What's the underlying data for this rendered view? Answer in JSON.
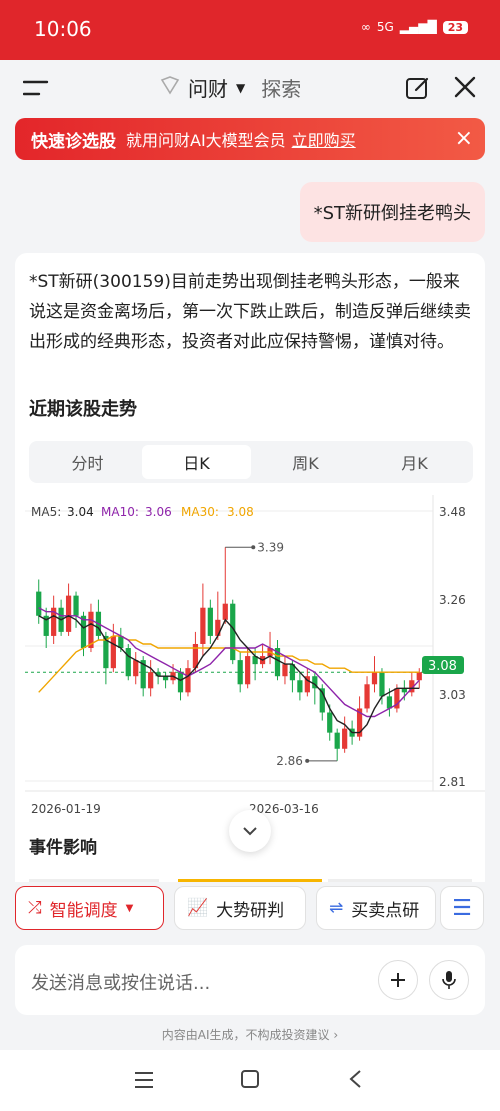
{
  "status_bar": {
    "time": "10:06",
    "network": "5G",
    "battery": "23"
  },
  "header": {
    "app_title": "问财",
    "secondary_tab": "探索"
  },
  "banner": {
    "title": "快速诊选股",
    "text": "就用问财AI大模型会员",
    "link": "立即购买"
  },
  "user_message": "*ST新研倒挂老鸭头",
  "answer": {
    "text": "*ST新研(300159)目前走势出现倒挂老鸭头形态，一般来说这是资金离场后，第一次下跌止跌后，制造反弹后继续卖出形成的经典形态，投资者对此应保持警惕，谨慎对待。",
    "section_title": "近期该股走势",
    "tabs": [
      "分时",
      "日K",
      "周K",
      "月K"
    ],
    "active_tab": "日K",
    "events_title": "事件影响"
  },
  "chart_data": {
    "type": "candlestick",
    "ma_labels": [
      {
        "name": "MA5:",
        "value": "3.04",
        "color": "#222222"
      },
      {
        "name": "MA10:",
        "value": "3.06",
        "color": "#8e24aa"
      },
      {
        "name": "MA30:",
        "value": "3.08",
        "color": "#f0a500"
      }
    ],
    "y_ticks": [
      "3.48",
      "3.26",
      "3.03",
      "2.81"
    ],
    "x_ticks": [
      "2026-01-19",
      "2026-03-16"
    ],
    "current_price": "3.08",
    "max_label": "3.39",
    "min_label": "2.86",
    "ylim": [
      2.81,
      3.48
    ],
    "candles": [
      [
        3.28,
        3.22,
        3.31,
        3.2
      ],
      [
        3.22,
        3.17,
        3.24,
        3.14
      ],
      [
        3.17,
        3.24,
        3.27,
        3.15
      ],
      [
        3.24,
        3.18,
        3.26,
        3.17
      ],
      [
        3.18,
        3.27,
        3.3,
        3.17
      ],
      [
        3.27,
        3.22,
        3.28,
        3.19
      ],
      [
        3.22,
        3.14,
        3.23,
        3.12
      ],
      [
        3.14,
        3.23,
        3.25,
        3.13
      ],
      [
        3.23,
        3.17,
        3.26,
        3.16
      ],
      [
        3.17,
        3.09,
        3.18,
        3.05
      ],
      [
        3.09,
        3.17,
        3.2,
        3.08
      ],
      [
        3.17,
        3.14,
        3.19,
        3.13
      ],
      [
        3.14,
        3.07,
        3.15,
        3.06
      ],
      [
        3.07,
        3.11,
        3.13,
        3.05
      ],
      [
        3.11,
        3.04,
        3.12,
        3.02
      ],
      [
        3.04,
        3.08,
        3.11,
        3.02
      ],
      [
        3.08,
        3.07,
        3.09,
        3.05
      ],
      [
        3.07,
        3.06,
        3.08,
        3.04
      ],
      [
        3.06,
        3.08,
        3.1,
        3.05
      ],
      [
        3.08,
        3.03,
        3.09,
        3.01
      ],
      [
        3.03,
        3.09,
        3.11,
        3.02
      ],
      [
        3.09,
        3.15,
        3.18,
        3.08
      ],
      [
        3.15,
        3.24,
        3.3,
        3.12
      ],
      [
        3.24,
        3.17,
        3.26,
        3.15
      ],
      [
        3.17,
        3.21,
        3.28,
        3.16
      ],
      [
        3.21,
        3.25,
        3.39,
        3.2
      ],
      [
        3.25,
        3.11,
        3.26,
        3.1
      ],
      [
        3.11,
        3.05,
        3.13,
        3.03
      ],
      [
        3.05,
        3.12,
        3.14,
        3.04
      ],
      [
        3.12,
        3.1,
        3.14,
        3.06
      ],
      [
        3.1,
        3.12,
        3.15,
        3.09
      ],
      [
        3.12,
        3.14,
        3.18,
        3.1
      ],
      [
        3.14,
        3.07,
        3.16,
        3.06
      ],
      [
        3.07,
        3.1,
        3.12,
        3.05
      ],
      [
        3.1,
        3.06,
        3.11,
        3.03
      ],
      [
        3.06,
        3.03,
        3.08,
        3.01
      ],
      [
        3.03,
        3.07,
        3.09,
        3.02
      ],
      [
        3.07,
        3.04,
        3.08,
        3.0
      ],
      [
        3.04,
        2.98,
        3.05,
        2.96
      ],
      [
        2.98,
        2.93,
        3.0,
        2.91
      ],
      [
        2.93,
        2.89,
        2.94,
        2.86
      ],
      [
        2.89,
        2.94,
        2.97,
        2.88
      ],
      [
        2.94,
        2.92,
        2.96,
        2.9
      ],
      [
        2.92,
        2.99,
        3.02,
        2.91
      ],
      [
        2.99,
        3.05,
        3.07,
        2.98
      ],
      [
        3.05,
        3.08,
        3.12,
        3.03
      ],
      [
        3.08,
        3.02,
        3.09,
        3.0
      ],
      [
        3.02,
        2.99,
        3.04,
        2.97
      ],
      [
        2.99,
        3.04,
        3.05,
        2.98
      ],
      [
        3.04,
        3.03,
        3.06,
        3.01
      ],
      [
        3.03,
        3.06,
        3.08,
        3.02
      ],
      [
        3.06,
        3.08,
        3.09,
        3.04
      ]
    ],
    "ma5": [
      3.22,
      3.21,
      3.22,
      3.21,
      3.22,
      3.21,
      3.19,
      3.2,
      3.19,
      3.16,
      3.15,
      3.14,
      3.12,
      3.11,
      3.1,
      3.09,
      3.07,
      3.07,
      3.07,
      3.06,
      3.07,
      3.09,
      3.12,
      3.14,
      3.17,
      3.21,
      3.19,
      3.16,
      3.14,
      3.12,
      3.11,
      3.12,
      3.11,
      3.1,
      3.1,
      3.08,
      3.06,
      3.05,
      3.03,
      2.99,
      2.96,
      2.95,
      2.93,
      2.93,
      2.95,
      2.99,
      3.02,
      3.03,
      3.04,
      3.04,
      3.04,
      3.04
    ],
    "ma10": [
      3.24,
      3.23,
      3.23,
      3.22,
      3.22,
      3.22,
      3.21,
      3.21,
      3.2,
      3.19,
      3.18,
      3.17,
      3.16,
      3.14,
      3.13,
      3.12,
      3.11,
      3.1,
      3.09,
      3.08,
      3.07,
      3.08,
      3.09,
      3.1,
      3.12,
      3.14,
      3.14,
      3.14,
      3.14,
      3.14,
      3.15,
      3.14,
      3.13,
      3.12,
      3.11,
      3.1,
      3.09,
      3.08,
      3.06,
      3.04,
      3.02,
      3.0,
      2.99,
      2.98,
      2.97,
      2.97,
      2.98,
      2.99,
      3.0,
      3.02,
      3.04,
      3.06
    ],
    "ma30": [
      3.03,
      3.05,
      3.07,
      3.09,
      3.11,
      3.13,
      3.14,
      3.15,
      3.16,
      3.16,
      3.17,
      3.17,
      3.16,
      3.16,
      3.15,
      3.15,
      3.14,
      3.14,
      3.14,
      3.14,
      3.14,
      3.14,
      3.14,
      3.14,
      3.14,
      3.14,
      3.14,
      3.13,
      3.13,
      3.13,
      3.13,
      3.13,
      3.12,
      3.12,
      3.12,
      3.11,
      3.11,
      3.1,
      3.1,
      3.09,
      3.09,
      3.09,
      3.08,
      3.08,
      3.08,
      3.08,
      3.08,
      3.08,
      3.08,
      3.08,
      3.08,
      3.08
    ]
  },
  "quick_actions": [
    {
      "label": "智能调度",
      "icon": "shuffle-icon"
    },
    {
      "label": "大势研判",
      "icon": "trend-chart-icon"
    },
    {
      "label": "买卖点研",
      "icon": "exchange-icon"
    }
  ],
  "input": {
    "placeholder": "发送消息或按住说话..."
  },
  "disclaimer": "内容由AI生成，不构成投资建议",
  "colors": {
    "brand_red": "#e0262b",
    "up": "#e53935",
    "down": "#1aa64a",
    "ma10": "#8e24aa",
    "ma30": "#f0a500"
  }
}
